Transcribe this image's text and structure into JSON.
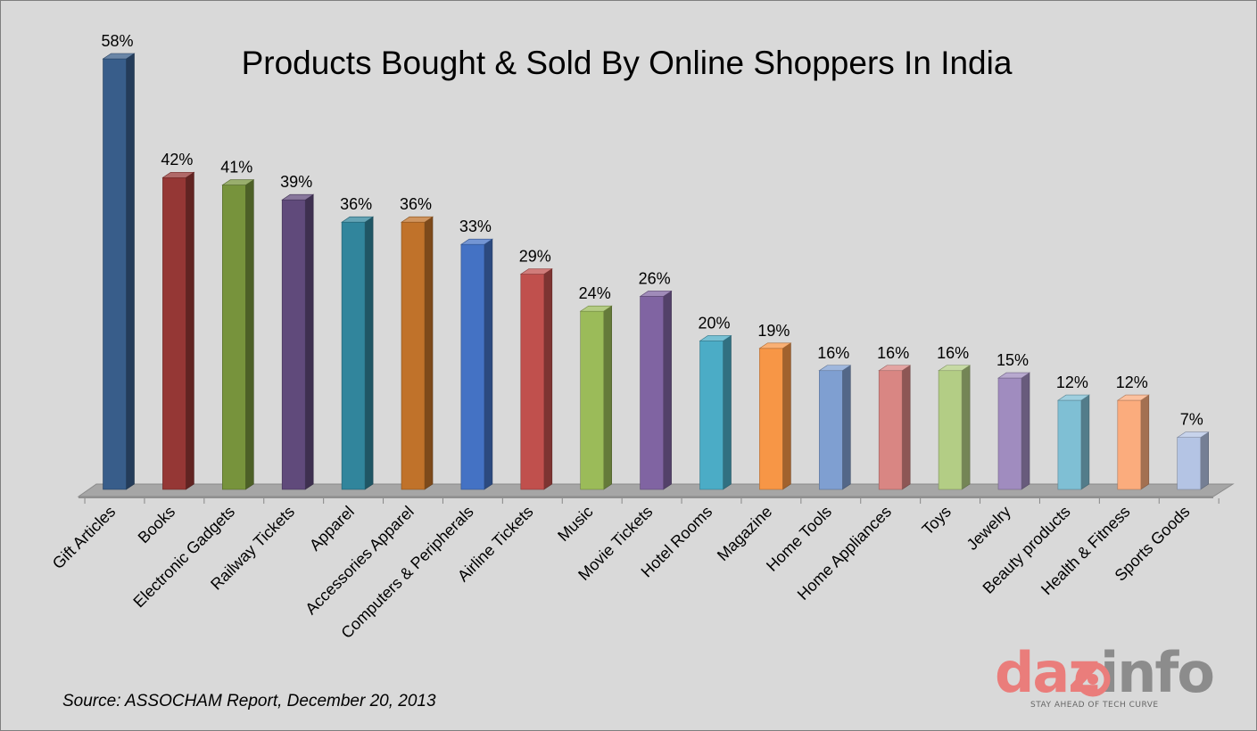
{
  "chart_data": {
    "type": "bar",
    "title": "Products Bought & Sold By Online Shoppers In India",
    "source": "Source: ASSOCHAM Report, December 20, 2013",
    "categories": [
      "Gift Articles",
      "Books",
      "Electronic Gadgets",
      "Railway Tickets",
      "Apparel",
      "Accessories Apparel",
      "Computers & Peripherals",
      "Airline Tickets",
      "Music",
      "Movie Tickets",
      "Hotel Rooms",
      "Magazine",
      "Home Tools",
      "Home Appliances",
      "Toys",
      "Jewelry",
      "Beauty products",
      "Health & Fitness",
      "Sports Goods"
    ],
    "values": [
      58,
      42,
      41,
      39,
      36,
      36,
      33,
      29,
      24,
      26,
      20,
      19,
      16,
      16,
      16,
      15,
      12,
      12,
      7
    ],
    "value_labels": [
      "58%",
      "42%",
      "41%",
      "39%",
      "36%",
      "36%",
      "33%",
      "29%",
      "24%",
      "26%",
      "20%",
      "19%",
      "16%",
      "16%",
      "16%",
      "15%",
      "12%",
      "12%",
      "7%"
    ],
    "colors": [
      "#385d8a",
      "#953735",
      "#77933c",
      "#604a7b",
      "#31859c",
      "#c0722a",
      "#4472c4",
      "#c0504d",
      "#9bbb59",
      "#8064a2",
      "#4bacc6",
      "#f79646",
      "#7f9fd1",
      "#d98683",
      "#b3cd85",
      "#a08cbf",
      "#7fbfd4",
      "#fbac7d",
      "#b4c4e4"
    ],
    "ylim": [
      0,
      58
    ],
    "grid": false,
    "legend": "none",
    "bar_style": "3d"
  },
  "logo": {
    "part1": "daz",
    "part2": "info",
    "tagline": "STAY AHEAD OF TECH CURVE",
    "colors": {
      "primary": "#ea7d7b",
      "secondary": "#8c8c8c"
    }
  },
  "colors": {
    "background": "#d9d9d9",
    "floor": "#a6a6a6"
  }
}
